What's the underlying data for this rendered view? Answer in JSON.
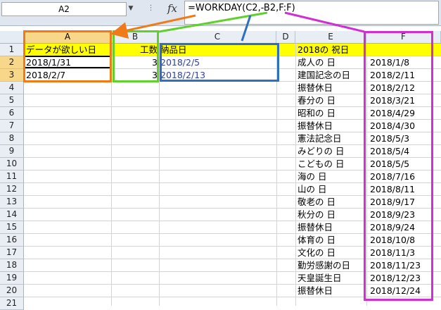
{
  "formula_bar": {
    "name_box": "A2",
    "name_box_arrow": "▼",
    "dots": "⋮",
    "fx_label": "fx",
    "formula": "=WORKDAY(C2,-B2,F:F)"
  },
  "columns": [
    "A",
    "B",
    "C",
    "D",
    "E",
    "F"
  ],
  "selected_column": "A",
  "rows": [
    "1",
    "2",
    "3",
    "4",
    "5",
    "6",
    "7",
    "8",
    "9",
    "10",
    "11",
    "12",
    "13",
    "14",
    "15",
    "16",
    "17",
    "18",
    "19",
    "20",
    "21"
  ],
  "selected_rows": [
    "2",
    "3"
  ],
  "header_row": {
    "A": "データが欲しい日",
    "B": "工数",
    "C": "納品日",
    "E": "2018の 祝日"
  },
  "data_rows": [
    {
      "A": "2018/1/31",
      "B": "3",
      "C": "2018/2/5"
    },
    {
      "A": "2018/2/7",
      "B": "3",
      "C": "2018/2/13"
    }
  ],
  "holidays": [
    {
      "name": "成人の 日",
      "date": "2018/1/8"
    },
    {
      "name": "建国記念の日",
      "date": "2018/2/11"
    },
    {
      "name": "振替休日",
      "date": "2018/2/12"
    },
    {
      "name": "春分の 日",
      "date": "2018/3/21"
    },
    {
      "name": "昭和の 日",
      "date": "2018/4/29"
    },
    {
      "name": "振替休日",
      "date": "2018/4/30"
    },
    {
      "name": "憲法記念日",
      "date": "2018/5/3"
    },
    {
      "name": "みどりの 日",
      "date": "2018/5/4"
    },
    {
      "name": "こどもの 日",
      "date": "2018/5/5"
    },
    {
      "name": "海の 日",
      "date": "2018/7/16"
    },
    {
      "name": "山の 日",
      "date": "2018/8/11"
    },
    {
      "name": "敬老の 日",
      "date": "2018/9/17"
    },
    {
      "name": "秋分の 日",
      "date": "2018/9/23"
    },
    {
      "name": "振替休日",
      "date": "2018/9/24"
    },
    {
      "name": "体育の 日",
      "date": "2018/10/8"
    },
    {
      "name": "文化の 日",
      "date": "2018/11/3"
    },
    {
      "name": "勤労感謝の日",
      "date": "2018/11/23"
    },
    {
      "name": "天皇誕生日",
      "date": "2018/12/23"
    },
    {
      "name": "振替休日",
      "date": "2018/12/24"
    }
  ],
  "colors": {
    "header_fill": "#ffff00",
    "selected_header": "#f8d68a",
    "date_text": "#2b3fb0",
    "annot_orange": "#f07a18",
    "annot_green": "#5fd02c",
    "annot_blue": "#2f6fc0",
    "annot_magenta": "#d12fd1"
  }
}
